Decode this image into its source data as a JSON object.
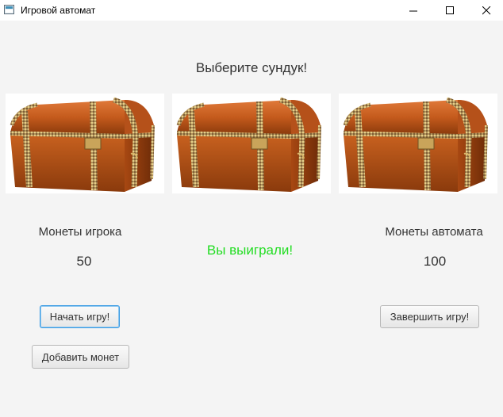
{
  "window": {
    "title": "Игровой автомат",
    "icon": "java-app-icon"
  },
  "main": {
    "heading": "Выберите сундук!",
    "chests": [
      "chest-1",
      "chest-2",
      "chest-3"
    ],
    "player": {
      "label": "Монеты игрока",
      "coins": "50"
    },
    "machine": {
      "label": "Монеты автомата",
      "coins": "100"
    },
    "result": "Вы выиграли!",
    "result_color": "#22dd22"
  },
  "buttons": {
    "start": "Начать игру!",
    "add_coins": "Добавить монет",
    "finish": "Завершить игру!"
  }
}
